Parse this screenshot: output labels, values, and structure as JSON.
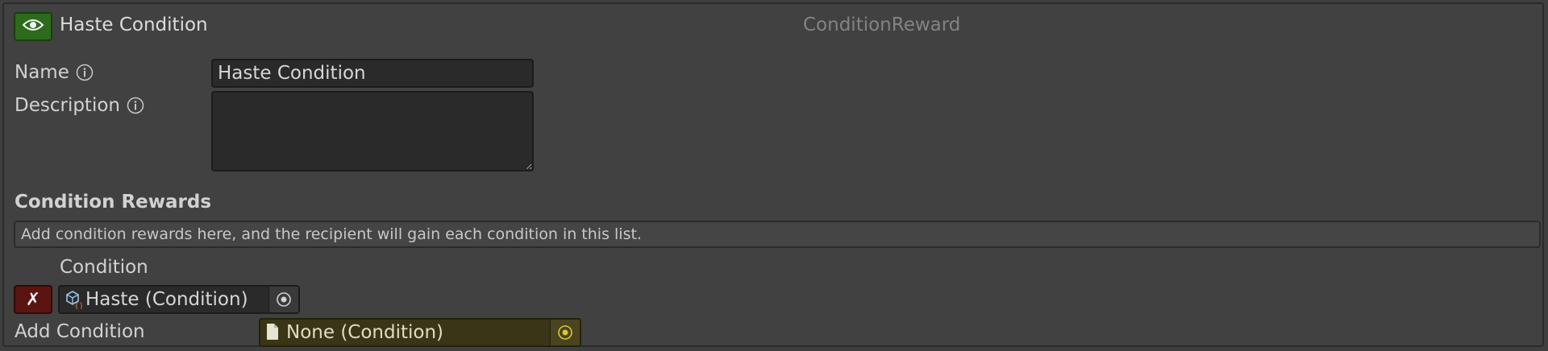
{
  "header": {
    "title": "Haste Condition",
    "type_name": "ConditionReward",
    "visibility_icon": "eye-icon"
  },
  "fields": {
    "name": {
      "label": "Name",
      "value": "Haste Condition",
      "info_icon": "info-icon"
    },
    "description": {
      "label": "Description",
      "value": "",
      "info_icon": "info-icon"
    }
  },
  "condition_rewards": {
    "title": "Condition Rewards",
    "help_text": "Add condition rewards here, and the recipient will gain each condition in this list.",
    "column_header": "Condition",
    "items": [
      {
        "delete_label": "✗",
        "value": "Haste (Condition)",
        "icon": "scriptable-object-icon"
      }
    ],
    "add": {
      "label": "Add Condition",
      "value": "None (Condition)",
      "icon": "document-icon"
    }
  },
  "colors": {
    "visibility_button": "#2c6a1c",
    "delete_button": "#5b1510",
    "add_field_bg": "#3a3516",
    "picker_accent": "#d7c82e"
  }
}
